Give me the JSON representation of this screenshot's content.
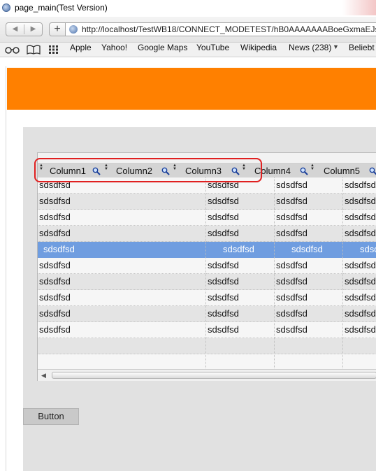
{
  "window": {
    "title": "page_main(Test Version)"
  },
  "toolbar": {
    "back_glyph": "◀",
    "forward_glyph": "▶",
    "add_glyph": "+",
    "url": "http://localhost/TestWB18/CONNECT_MODETEST/hB0AAAAAAABoeGxmaEJsV"
  },
  "bookmarks": {
    "items": [
      {
        "label": "Apple"
      },
      {
        "label": "Yahoo!"
      },
      {
        "label": "Google Maps"
      },
      {
        "label": "YouTube"
      },
      {
        "label": "Wikipedia"
      },
      {
        "label": "News (238)"
      },
      {
        "label": "Beliebt"
      }
    ]
  },
  "grid": {
    "columns": [
      {
        "label": "Column1"
      },
      {
        "label": "Column2"
      },
      {
        "label": "Column3"
      },
      {
        "label": "Column4"
      },
      {
        "label": "Column5"
      }
    ],
    "rows": [
      [
        "sdsdfsd",
        "sdsdfsd",
        "sdsdfsd",
        "sdsdfsd"
      ],
      [
        "sdsdfsd",
        "sdsdfsd",
        "sdsdfsd",
        "sdsdfsd"
      ],
      [
        "sdsdfsd",
        "sdsdfsd",
        "sdsdfsd",
        "sdsdfsd"
      ],
      [
        "sdsdfsd",
        "sdsdfsd",
        "sdsdfsd",
        "sdsdfsd"
      ],
      [
        "sdsdfsd",
        "sdsdfsd",
        "sdsdfsd",
        "sdsd"
      ],
      [
        "sdsdfsd",
        "sdsdfsd",
        "sdsdfsd",
        "sdsdfsd"
      ],
      [
        "sdsdfsd",
        "sdsdfsd",
        "sdsdfsd",
        "sdsdfsd"
      ],
      [
        "sdsdfsd",
        "sdsdfsd",
        "sdsdfsd",
        "sdsdfsd"
      ],
      [
        "sdsdfsd",
        "sdsdfsd",
        "sdsdfsd",
        "sdsdfsd"
      ],
      [
        "sdsdfsd",
        "sdsdfsd",
        "sdsdfsd",
        "sdsdfsd"
      ]
    ],
    "selected_row": 4,
    "scroll_left_glyph": "◀"
  },
  "button": {
    "label": "Button"
  },
  "colors": {
    "banner": "#ff8000",
    "selection": "#6f9de0",
    "highlight_outline": "#e02020"
  }
}
